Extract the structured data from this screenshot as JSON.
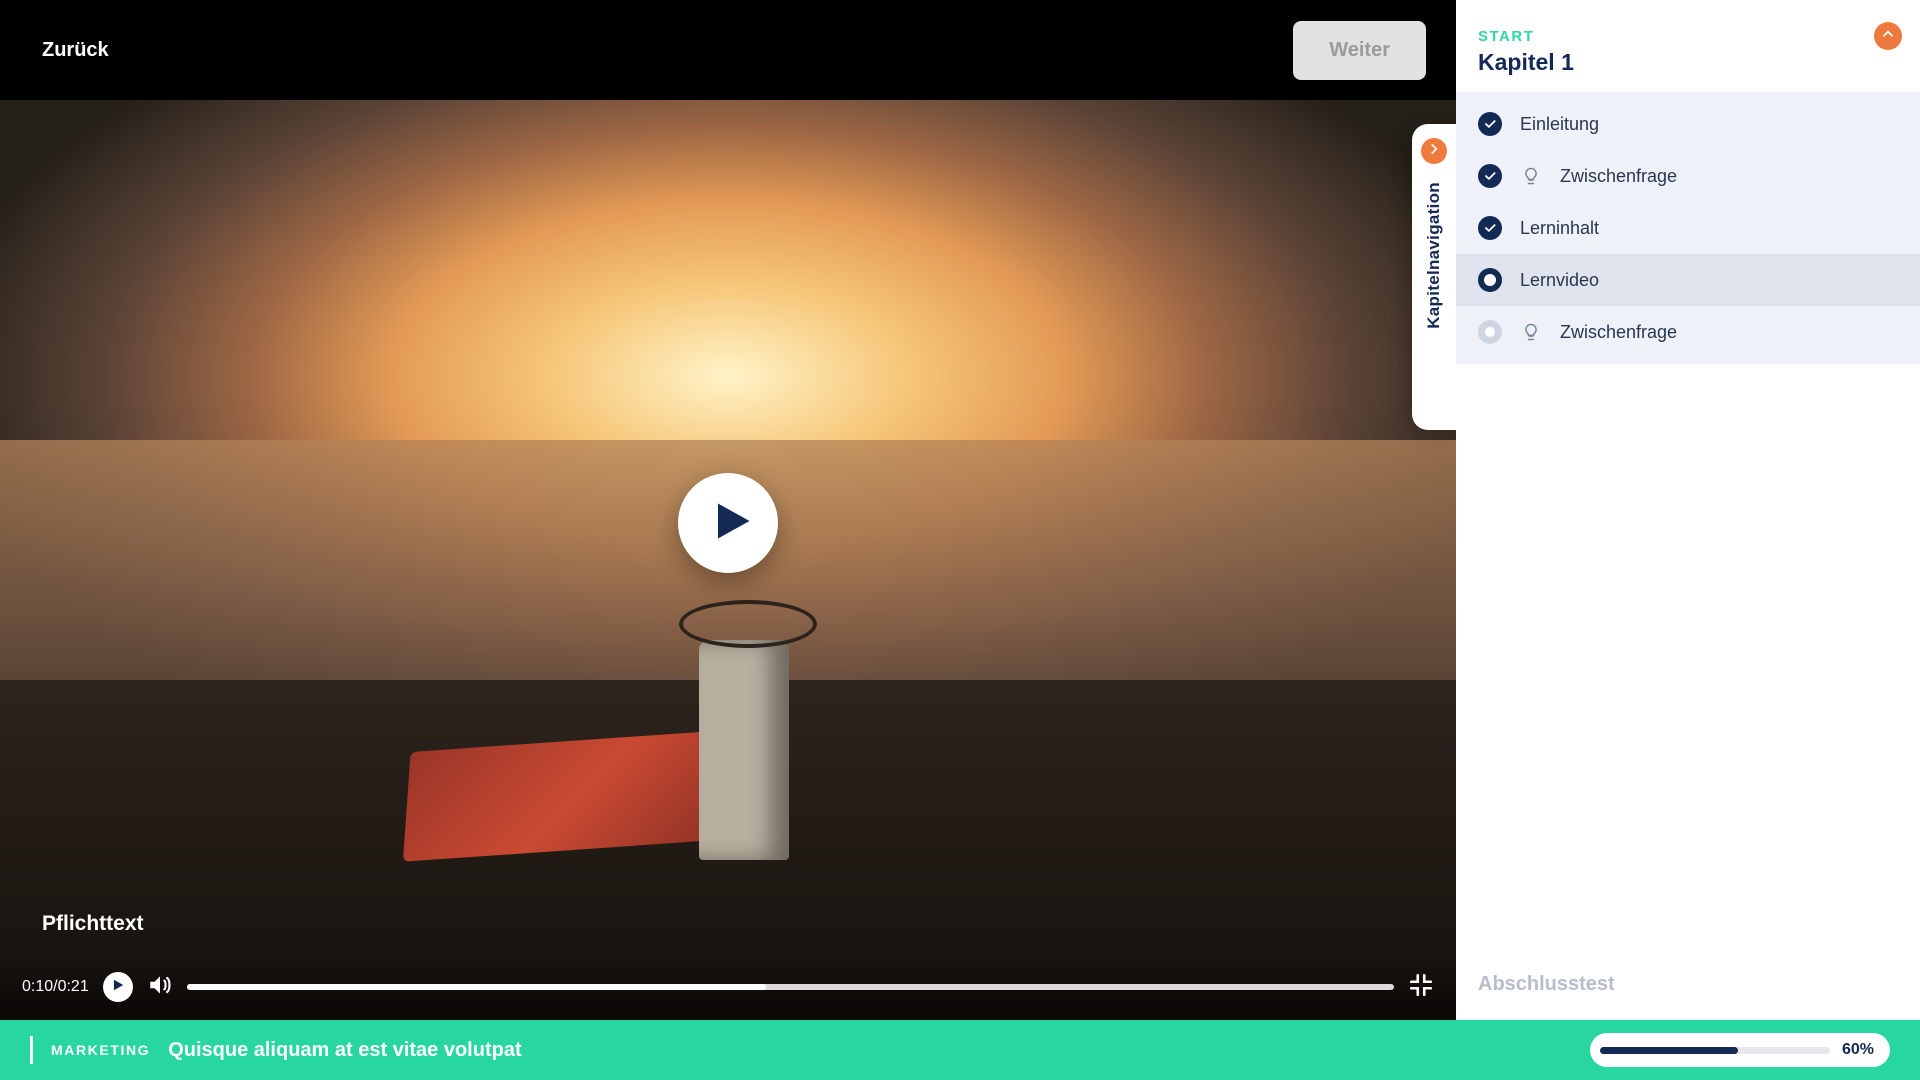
{
  "topbar": {
    "back_label": "Zurück",
    "next_label": "Weiter"
  },
  "video": {
    "current_time": "0:10",
    "duration": "0:21",
    "time_display": "0:10/0:21",
    "progress_pct": 48,
    "overlay_label": "Pflichttext"
  },
  "navtab": {
    "label": "Kapitelnavigation"
  },
  "sidebar": {
    "start_label": "START",
    "chapter_title": "Kapitel 1",
    "final_test_label": "Abschlusstest",
    "items": [
      {
        "label": "Einleitung",
        "status": "done",
        "type": "text"
      },
      {
        "label": "Zwischenfrage",
        "status": "done",
        "type": "quiz"
      },
      {
        "label": "Lerninhalt",
        "status": "done",
        "type": "text"
      },
      {
        "label": "Lernvideo",
        "status": "current",
        "type": "video"
      },
      {
        "label": "Zwischenfrage",
        "status": "pending",
        "type": "quiz"
      }
    ]
  },
  "bottombar": {
    "category": "MARKETING",
    "title": "Quisque aliquam at est vitae volutpat",
    "progress_pct": 60,
    "progress_label": "60%"
  }
}
